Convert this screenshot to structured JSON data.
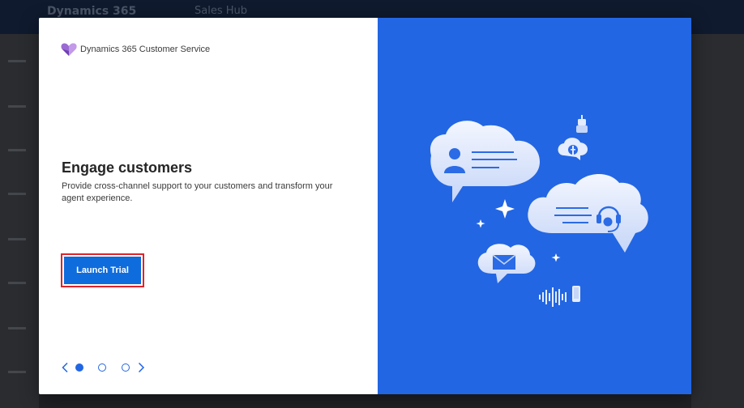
{
  "background_app": {
    "title": "Dynamics 365",
    "subtitle": "Sales Hub"
  },
  "modal": {
    "brand": {
      "logo_icon": "dynamics-heart-logo",
      "name": "Dynamics 365 Customer Service"
    },
    "heading": "Engage customers",
    "description": "Provide cross-channel support to your customers and transform your agent experience.",
    "launch_button": "Launch Trial",
    "pager": {
      "prev_icon": "chevron-left-icon",
      "next_icon": "chevron-right-icon",
      "total_pages": 3,
      "current_page": 1
    },
    "illustration": {
      "icons": [
        "chat-cloud",
        "person-icon",
        "headset-icon",
        "mail-icon",
        "facebook-icon",
        "bot-icon",
        "sparkle-icon",
        "voice-wave-icon",
        "phone-icon"
      ]
    }
  },
  "colors": {
    "accent_blue": "#2266e3",
    "button_blue": "#0f6cdc",
    "highlight_red": "#e0232a",
    "logo_purple": "#9b6bd3"
  }
}
